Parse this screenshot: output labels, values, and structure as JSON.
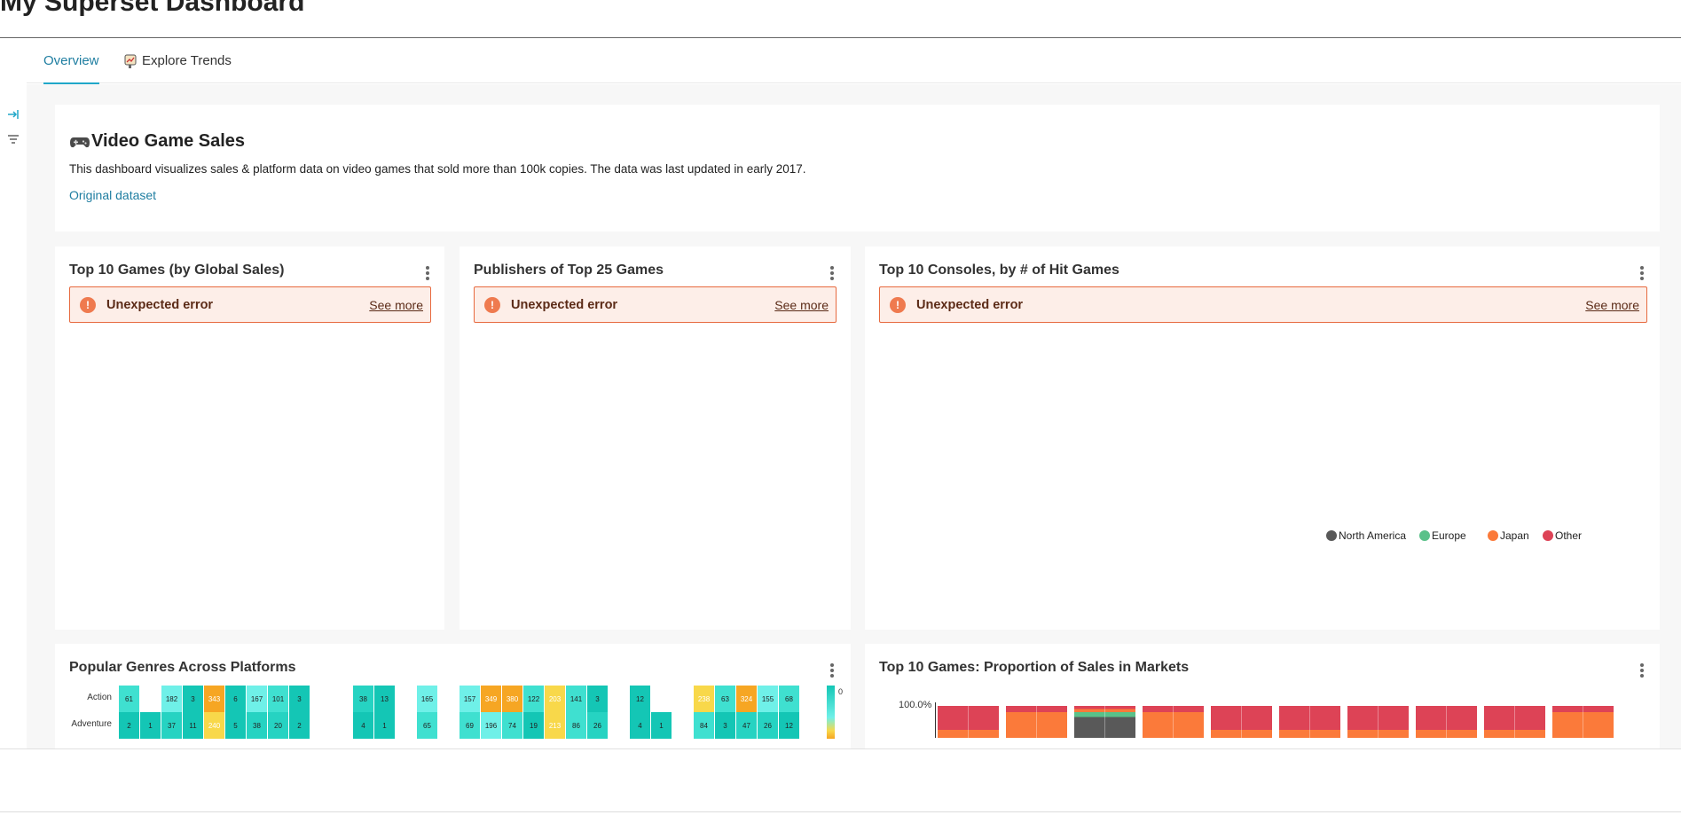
{
  "header": {
    "title": "My Superset Dashboard"
  },
  "tabs": [
    {
      "label": "Overview"
    },
    {
      "label": "Explore Trends"
    }
  ],
  "intro": {
    "title": "Video Game Sales",
    "description": "This dashboard visualizes sales & platform data on video games that sold more than 100k copies. The data was last updated in early 2017.",
    "link": "Original dataset"
  },
  "charts": {
    "top_games": {
      "title": "Top 10 Games (by Global Sales)",
      "error": "Unexpected error",
      "see_more": "See more"
    },
    "publishers": {
      "title": "Publishers of Top 25 Games",
      "error": "Unexpected error",
      "see_more": "See more"
    },
    "consoles": {
      "title": "Top 10 Consoles, by # of Hit Games",
      "error": "Unexpected error",
      "see_more": "See more"
    },
    "genres": {
      "title": "Popular Genres Across Platforms"
    },
    "markets": {
      "title": "Top 10 Games: Proportion of Sales in Markets"
    }
  },
  "heatmap": {
    "rows": [
      "Action",
      "Adventure"
    ],
    "action_values": [
      "61",
      "",
      "182",
      "3",
      "343",
      "6",
      "167",
      "101",
      "3",
      "",
      "",
      "38",
      "13",
      "",
      "165",
      "",
      "157",
      "349",
      "380",
      "122",
      "203",
      "141",
      "3",
      "",
      "12",
      "",
      "",
      "238",
      "63",
      "324",
      "155",
      "68"
    ],
    "adventure_values": [
      "2",
      "1",
      "37",
      "11",
      "240",
      "5",
      "38",
      "20",
      "2",
      "",
      "",
      "4",
      "1",
      "",
      "65",
      "",
      "69",
      "196",
      "74",
      "19",
      "213",
      "86",
      "26",
      "",
      "4",
      "1",
      "",
      "84",
      "3",
      "47",
      "26",
      "12"
    ],
    "scale_label": "0"
  },
  "markets_chart": {
    "legend": [
      {
        "name": "North America",
        "color": "#595959"
      },
      {
        "name": "Europe",
        "color": "#5ac189"
      },
      {
        "name": "Japan",
        "color": "#fb7a3a"
      },
      {
        "name": "Other",
        "color": "#dd4356"
      }
    ],
    "y_tick": "100.0%"
  },
  "colors": {
    "accent": "#20a7c9",
    "link": "#1f7ea1",
    "error_border": "#e76a3f",
    "error_bg": "#fdeee8"
  }
}
